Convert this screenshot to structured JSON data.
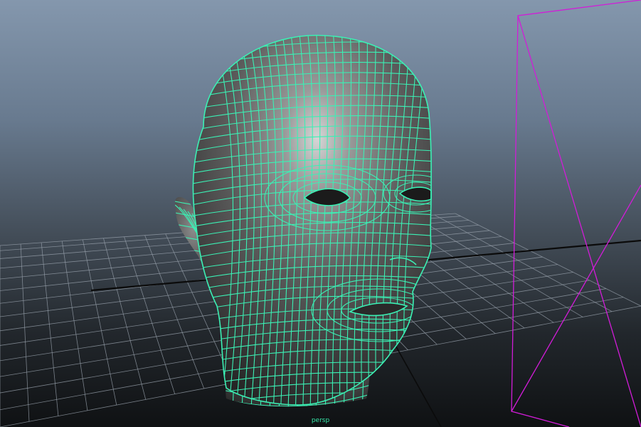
{
  "viewport": {
    "camera_label": "persp",
    "label_color": "#36e6a8"
  },
  "colors": {
    "wireframe": "#3bf0b4",
    "grid": "#9aa3ad",
    "grid_axis": "#0b0b0b",
    "camera_frustum": "#d21cd8"
  },
  "objects": {
    "head_mesh": "head-mesh-wireframe",
    "grid": "ground-grid",
    "camera": "camera-frustum"
  }
}
